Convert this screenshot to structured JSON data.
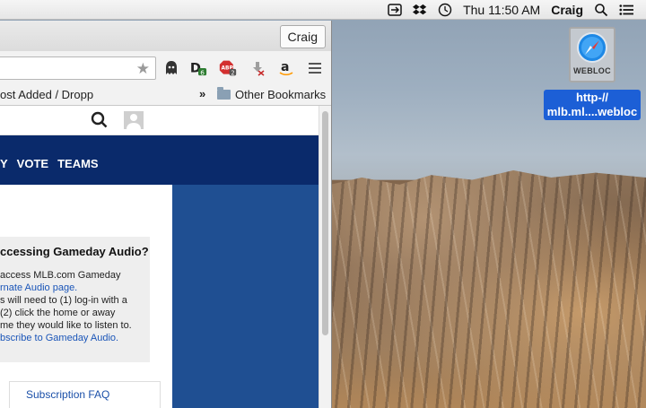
{
  "menubar": {
    "icons": [
      "screen-share-icon",
      "dropbox-icon",
      "time-machine-icon"
    ],
    "clock": "Thu 11:50 AM",
    "user": "Craig",
    "right_icons": [
      "spotlight-icon",
      "notification-center-icon"
    ]
  },
  "desktop_icon": {
    "tile_label": "WEBLOC",
    "name_line1": "http-//",
    "name_line2": "mlb.ml....webloc"
  },
  "browser": {
    "profile_button": "Craig",
    "extensions": [
      {
        "name": "ghostery-icon"
      },
      {
        "name": "disconnect-icon",
        "badge": "6"
      },
      {
        "name": "adblock-plus-icon",
        "label": "ABP",
        "badge": "2"
      },
      {
        "name": "download-icon"
      },
      {
        "name": "amazon-icon",
        "label": "a"
      },
      {
        "name": "menu-icon"
      }
    ],
    "bookmarks_left": "ost Added / Dropp",
    "bookmarks_more": "»",
    "other_bookmarks": "Other Bookmarks"
  },
  "page": {
    "nav": [
      "Y",
      "VOTE",
      "TEAMS"
    ],
    "box_title": "ccessing Gameday Audio?",
    "box_lines": [
      "access MLB.com Gameday",
      "rnate Audio page.",
      "s will need to (1) log-in with a",
      "(2) click the home or away",
      "me they would like to listen to.",
      "bscribe to Gameday Audio."
    ],
    "faq_link": "Subscription FAQ"
  },
  "colors": {
    "nav_bg": "#0a2a6b",
    "panel_blue": "#1f4f92",
    "selection_blue": "#1c5fd6"
  }
}
